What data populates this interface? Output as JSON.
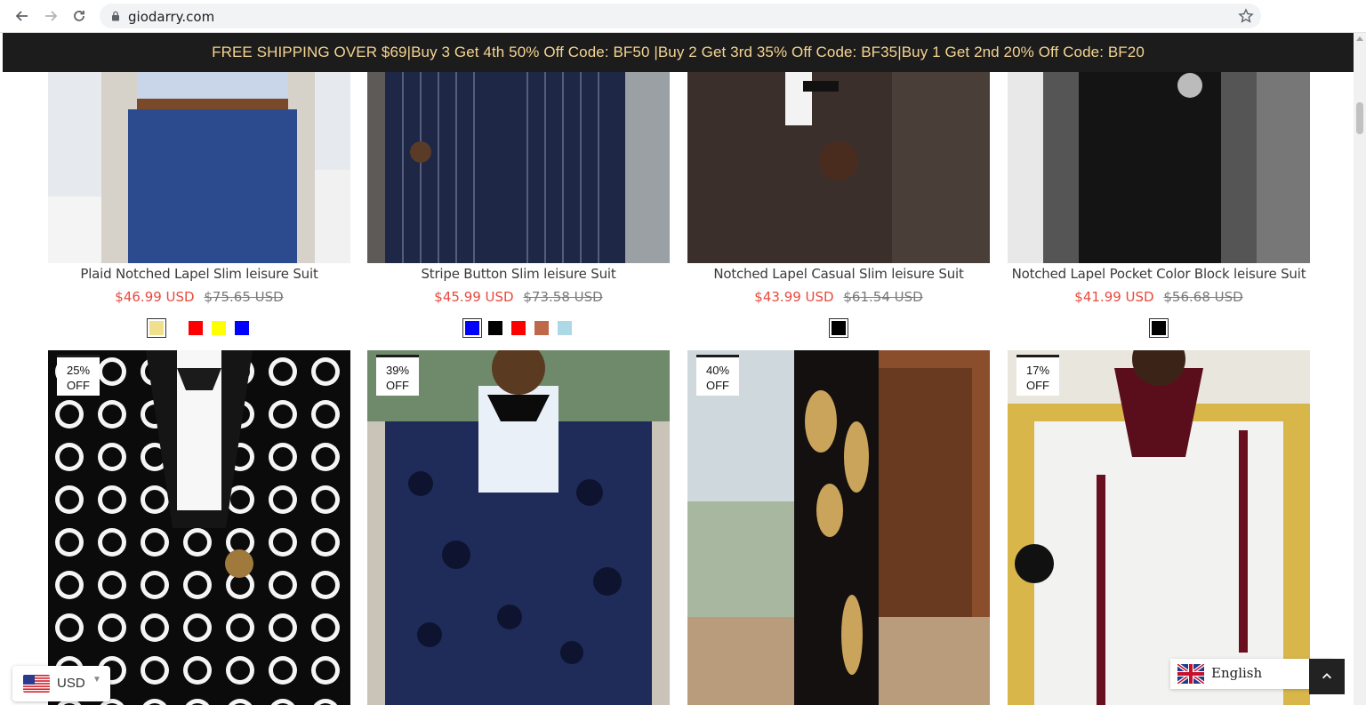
{
  "browser": {
    "url": "giodarry.com"
  },
  "promo_text": "FREE SHIPPING OVER $69|Buy 3 Get 4th 50% Off Code: BF50 |Buy 2 Get 3rd 35% Off Code: BF35|Buy 1 Get 2nd 20% Off Code: BF20",
  "products_top": [
    {
      "title": "Plaid Notched Lapel Slim leisure Suit",
      "price": "$46.99 USD",
      "compare_price": "$75.65 USD",
      "swatches": [
        "#f0e08e",
        "#ff0000",
        "#ffff00",
        "#0000ff"
      ]
    },
    {
      "title": "Stripe Button Slim leisure Suit",
      "price": "$45.99 USD",
      "compare_price": "$73.58 USD",
      "swatches": [
        "#0000ff",
        "#000000",
        "#ff0000",
        "#c0694a",
        "#add8e6"
      ]
    },
    {
      "title": "Notched Lapel Casual Slim leisure Suit",
      "price": "$43.99 USD",
      "compare_price": "$61.54 USD",
      "swatches": [
        "#000000"
      ]
    },
    {
      "title": "Notched Lapel Pocket Color Block leisure Suit",
      "price": "$41.99 USD",
      "compare_price": "$56.68 USD",
      "swatches": [
        "#000000"
      ]
    }
  ],
  "products_bottom": [
    {
      "badge_pct": "25%",
      "badge_off": "OFF"
    },
    {
      "badge_pct": "39%",
      "badge_off": "OFF"
    },
    {
      "badge_pct": "40%",
      "badge_off": "OFF"
    },
    {
      "badge_pct": "17%",
      "badge_off": "OFF"
    }
  ],
  "currency": {
    "code": "USD"
  },
  "language": {
    "label": "English"
  }
}
